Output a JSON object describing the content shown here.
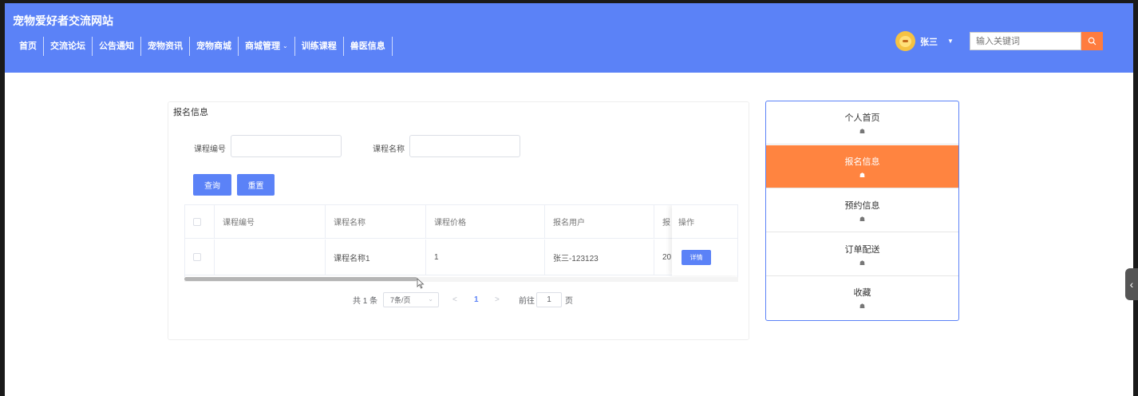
{
  "header": {
    "site_title": "宠物爱好者交流网站",
    "nav": [
      {
        "label": "首页"
      },
      {
        "label": "交流论坛"
      },
      {
        "label": "公告通知"
      },
      {
        "label": "宠物资讯"
      },
      {
        "label": "宠物商城"
      },
      {
        "label": "商城管理",
        "dropdown": true
      },
      {
        "label": "训练课程"
      },
      {
        "label": "兽医信息"
      }
    ],
    "username": "张三",
    "search_placeholder": "输入关键词"
  },
  "panel": {
    "title": "报名信息",
    "filters": {
      "course_code_label": "课程编号",
      "course_name_label": "课程名称"
    },
    "query_button": "查询",
    "reset_button": "重置"
  },
  "table": {
    "columns": [
      "课程编号",
      "课程名称",
      "课程价格",
      "报名用户",
      "报",
      "操作"
    ],
    "rows": [
      {
        "course_code": "",
        "course_name": "课程名称1",
        "price": "1",
        "user": "张三-123123",
        "signup_time_partial": "20",
        "action": "详情"
      }
    ]
  },
  "pagination": {
    "total": "共 1 条",
    "page_size": "7条/页",
    "prev": "<",
    "current": "1",
    "next": ">",
    "goto_prefix": "前往",
    "goto_value": "1",
    "goto_suffix": "页"
  },
  "side_menu": {
    "items": [
      {
        "label": "个人首页",
        "active": false
      },
      {
        "label": "报名信息",
        "active": true
      },
      {
        "label": "预约信息",
        "active": false
      },
      {
        "label": "订单配送",
        "active": false
      },
      {
        "label": "收藏",
        "active": false
      }
    ],
    "icon": "home-icon"
  },
  "colors": {
    "header_bg": "#5b82f7",
    "accent_orange": "#ff8440",
    "primary_blue": "#5b82f7"
  }
}
